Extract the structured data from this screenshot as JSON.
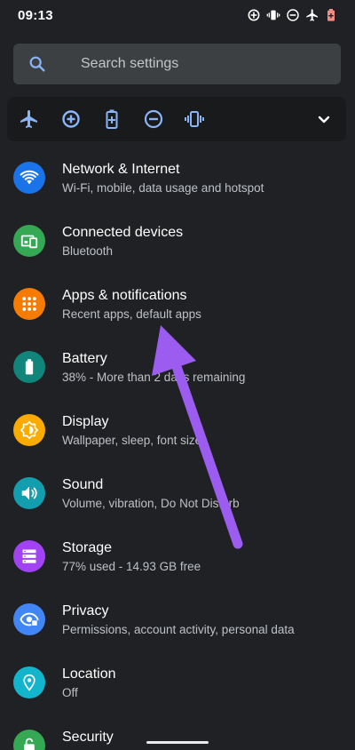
{
  "status_bar": {
    "time": "09:13",
    "icons": [
      "data-saver-icon",
      "vibrate-icon",
      "do-not-disturb-icon",
      "airplane-icon",
      "battery-saver-icon"
    ]
  },
  "search": {
    "placeholder": "Search settings",
    "icon": "search-icon"
  },
  "quick_settings": {
    "icons": [
      "airplane-icon",
      "data-saver-icon",
      "battery-saver-icon",
      "do-not-disturb-icon",
      "vibrate-icon",
      "chevron-down-icon"
    ],
    "accent": "#8ab4f8"
  },
  "settings": [
    {
      "title": "Network & Internet",
      "subtitle": "Wi-Fi, mobile, data usage and hotspot",
      "icon": "wifi-icon",
      "color": "#1a73e8"
    },
    {
      "title": "Connected devices",
      "subtitle": "Bluetooth",
      "icon": "devices-icon",
      "color": "#34a853"
    },
    {
      "title": "Apps & notifications",
      "subtitle": "Recent apps, default apps",
      "icon": "apps-icon",
      "color": "#f57c00"
    },
    {
      "title": "Battery",
      "subtitle": "38% - More than 2 days remaining",
      "icon": "battery-icon",
      "color": "#12857a"
    },
    {
      "title": "Display",
      "subtitle": "Wallpaper, sleep, font size",
      "icon": "display-icon",
      "color": "#f9ab00"
    },
    {
      "title": "Sound",
      "subtitle": "Volume, vibration, Do Not Disturb",
      "icon": "sound-icon",
      "color": "#129eaf"
    },
    {
      "title": "Storage",
      "subtitle": "77% used - 14.93 GB free",
      "icon": "storage-icon",
      "color": "#a142f4"
    },
    {
      "title": "Privacy",
      "subtitle": "Permissions, account activity, personal data",
      "icon": "privacy-icon",
      "color": "#4285f4"
    },
    {
      "title": "Location",
      "subtitle": "Off",
      "icon": "location-icon",
      "color": "#12b5cb"
    },
    {
      "title": "Security",
      "subtitle": "",
      "icon": "lock-icon",
      "color": "#34a853"
    }
  ],
  "annotation": {
    "arrow_color": "#9c5cf0"
  }
}
